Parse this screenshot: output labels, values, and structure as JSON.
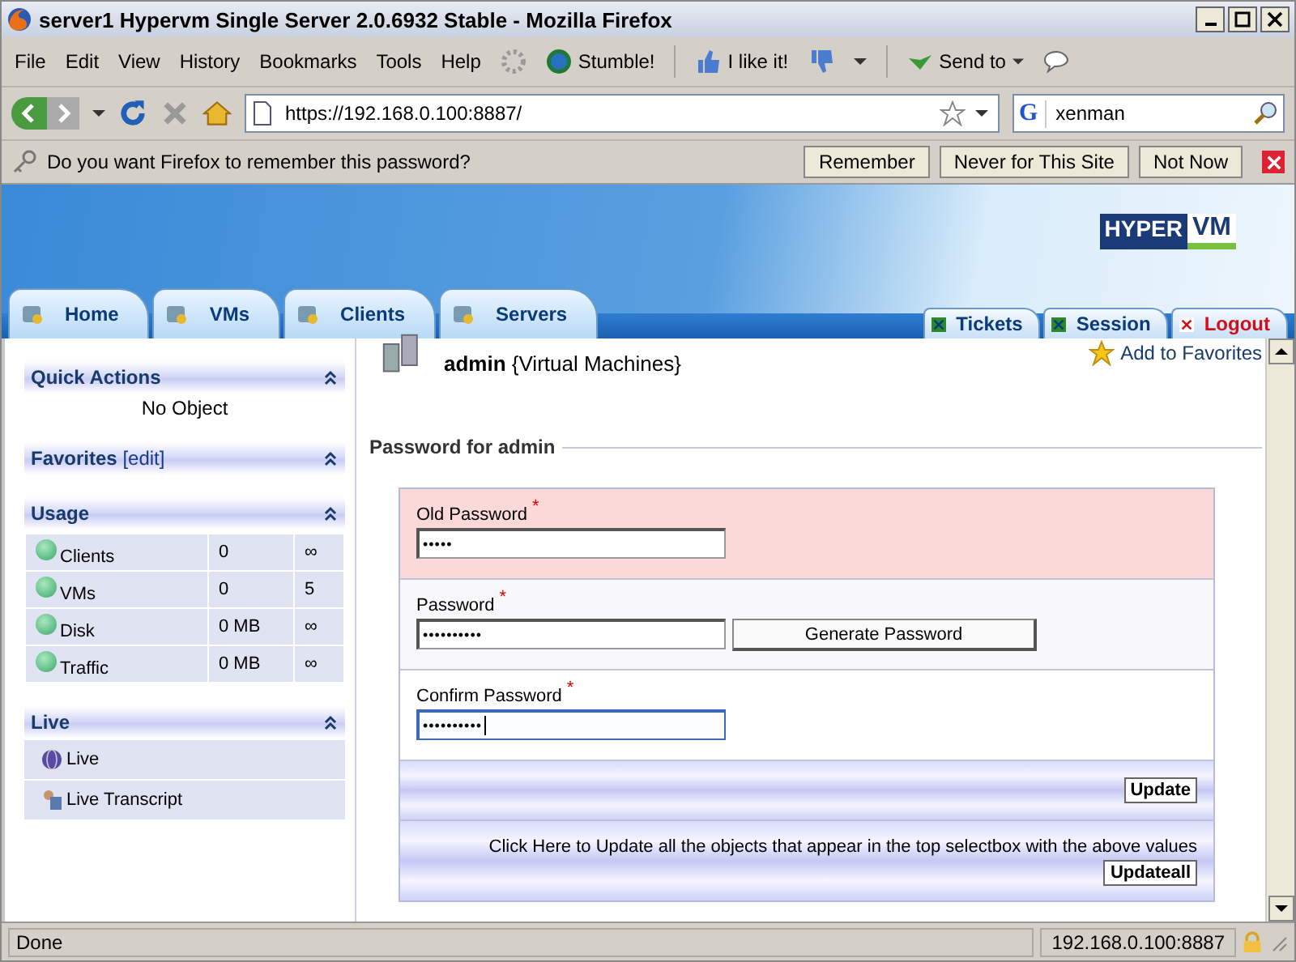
{
  "window": {
    "title": "server1 Hypervm Single Server 2.0.6932 Stable - Mozilla Firefox"
  },
  "menu": [
    "File",
    "Edit",
    "View",
    "History",
    "Bookmarks",
    "Tools",
    "Help"
  ],
  "toolbar": {
    "stumble": "Stumble!",
    "like": "I like it!",
    "send": "Send to"
  },
  "nav": {
    "url": "https://192.168.0.100:8887/",
    "engine": "G",
    "search": "xenman"
  },
  "password_bar": {
    "message": "Do you want Firefox to remember this password?",
    "buttons": [
      "Remember",
      "Never for This Site",
      "Not Now"
    ]
  },
  "tabs": [
    {
      "label": "Home"
    },
    {
      "label": "VMs"
    },
    {
      "label": "Clients"
    },
    {
      "label": "Servers"
    }
  ],
  "right_tabs": [
    {
      "label": "Tickets",
      "color": "#0a3a7a"
    },
    {
      "label": "Session",
      "color": "#0a3a7a"
    },
    {
      "label": "Logout",
      "color": "#d0101a"
    }
  ],
  "logo": {
    "left": "HYPER",
    "right": "VM"
  },
  "sidebar": {
    "quick_actions": {
      "title": "Quick Actions",
      "text": "No Object"
    },
    "favorites": {
      "title": "Favorites",
      "edit": "[edit]"
    },
    "usage": {
      "title": "Usage",
      "rows": [
        {
          "name": "Clients",
          "value": "0",
          "limit": "∞"
        },
        {
          "name": "VMs",
          "value": "0",
          "limit": "5"
        },
        {
          "name": "Disk",
          "value": "0 MB",
          "limit": "∞"
        },
        {
          "name": "Traffic",
          "value": "0 MB",
          "limit": "∞"
        }
      ]
    },
    "live": {
      "title": "Live",
      "items": [
        {
          "label": "Live",
          "kind": "globe"
        },
        {
          "label": "Live Transcript",
          "kind": "transcript"
        }
      ]
    }
  },
  "main": {
    "heading": "admin",
    "heading_note": "{Virtual Machines}",
    "add_favorites": "Add to Favorites",
    "section": "Password for admin",
    "required_mark": "*",
    "fields": [
      {
        "label": "Old Password",
        "required": true,
        "value": "•••••",
        "focused": false
      },
      {
        "label": "Password",
        "required": true,
        "value": "••••••••••",
        "focused": false,
        "button": "Generate Password"
      },
      {
        "label": "Confirm Password",
        "required": true,
        "value": "••••••••••",
        "focused": true
      }
    ],
    "update": "Update",
    "updateall_text": "Click Here to Update all the objects that appear in the top selectbox with the above values",
    "updateall": "Updateall"
  },
  "status": {
    "text": "Done",
    "address": "192.168.0.100:8887"
  }
}
